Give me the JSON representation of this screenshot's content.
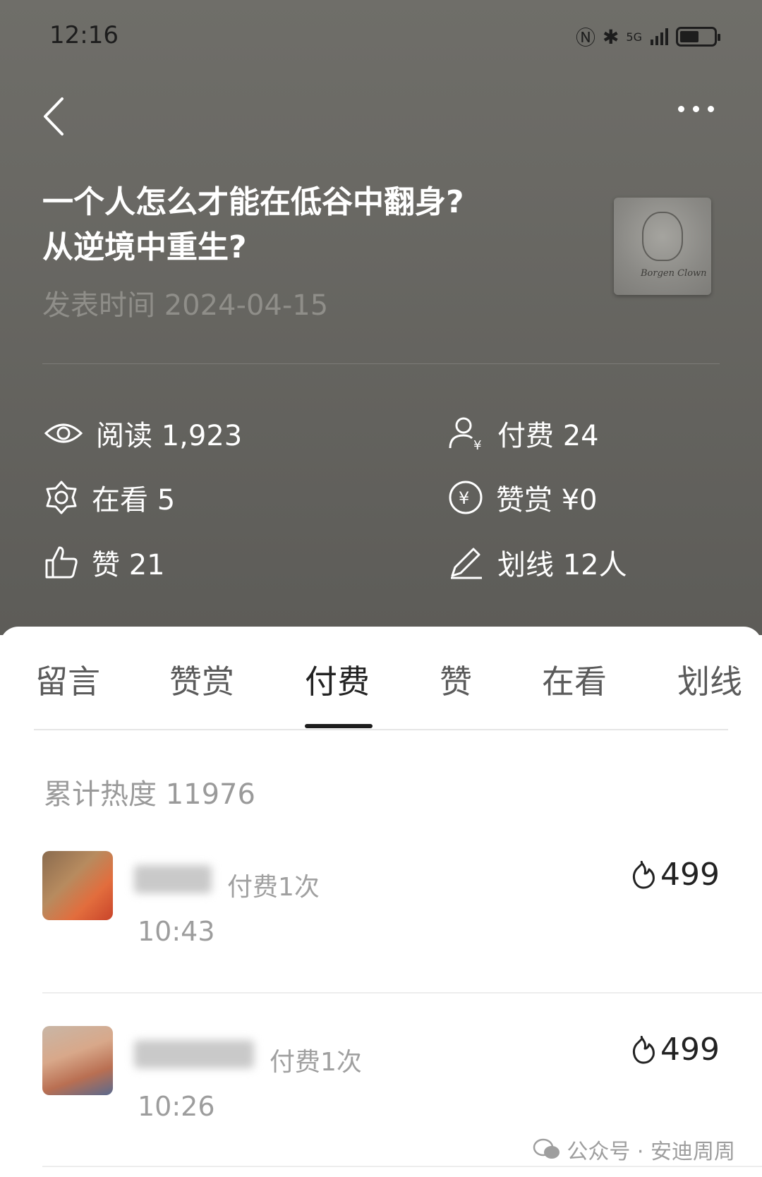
{
  "status_bar": {
    "time": "12:16",
    "network": "5G"
  },
  "header": {
    "title_line1": "一个人怎么才能在低谷中翻身?",
    "title_line2": "从逆境中重生?",
    "date": "发表时间 2024-04-15",
    "thumbnail_signature": "Borgen Clown"
  },
  "stats": {
    "read": "阅读 1,923",
    "paid": "付费 24",
    "watching": "在看 5",
    "reward": "赞赏 ¥0",
    "likes": "赞 21",
    "highlight": "划线 12人"
  },
  "tabs": [
    "留言",
    "赞赏",
    "付费",
    "赞",
    "在看",
    "划线"
  ],
  "active_tab": "付费",
  "heat_total": "累计热度 11976",
  "list": [
    {
      "pay_count": "付费1次",
      "time": "10:43",
      "amount": "499"
    },
    {
      "pay_count": "付费1次",
      "time": "10:26",
      "amount": "499"
    }
  ],
  "watermark": "公众号 · 安迪周周",
  "colors": {
    "header_bg": "#6f6e69",
    "accent": "#1d1d1d"
  }
}
